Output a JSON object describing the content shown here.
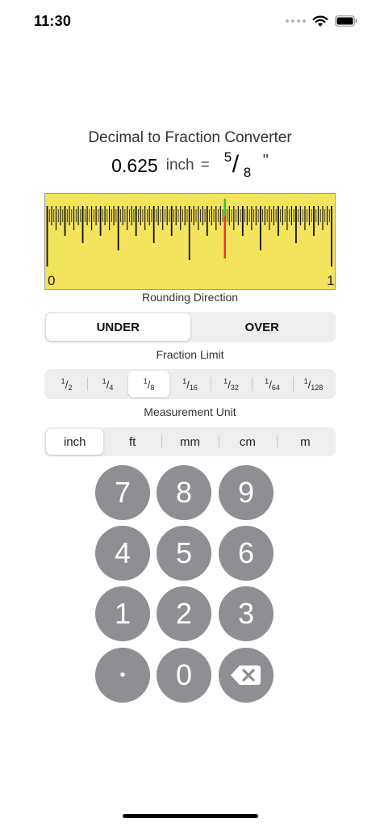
{
  "status": {
    "time": "11:30"
  },
  "header": {
    "title": "Decimal to Fraction Converter",
    "decimal_value": "0.625",
    "unit": "inch",
    "equals": "=",
    "fraction_numerator": "5",
    "fraction_slash": "/",
    "fraction_denominator": "8",
    "inch_mark": "\""
  },
  "ruler": {
    "start_label": "0",
    "end_label": "1",
    "value": 0.625,
    "value_fraction": "5/8",
    "subdivisions": 128,
    "fill_color": "#f4e35d",
    "rounded_mark_color": "#e1382a",
    "exact_mark_color": "#2fbf3f"
  },
  "rounding": {
    "label": "Rounding Direction",
    "options": [
      "UNDER",
      "OVER"
    ],
    "selected": "UNDER"
  },
  "fraction_limit": {
    "label": "Fraction Limit",
    "options": [
      {
        "num": "1",
        "den": "2"
      },
      {
        "num": "1",
        "den": "4"
      },
      {
        "num": "1",
        "den": "8"
      },
      {
        "num": "1",
        "den": "16"
      },
      {
        "num": "1",
        "den": "32"
      },
      {
        "num": "1",
        "den": "64"
      },
      {
        "num": "1",
        "den": "128"
      }
    ],
    "selected_index": 2
  },
  "measurement": {
    "label": "Measurement Unit",
    "options": [
      "inch",
      "ft",
      "mm",
      "cm",
      "m"
    ],
    "selected": "inch"
  },
  "keypad": {
    "keys": [
      "7",
      "8",
      "9",
      "4",
      "5",
      "6",
      "1",
      "2",
      "3",
      "•",
      "0"
    ],
    "backspace_icon": "backspace-icon",
    "key_color": "#8e8e93"
  }
}
